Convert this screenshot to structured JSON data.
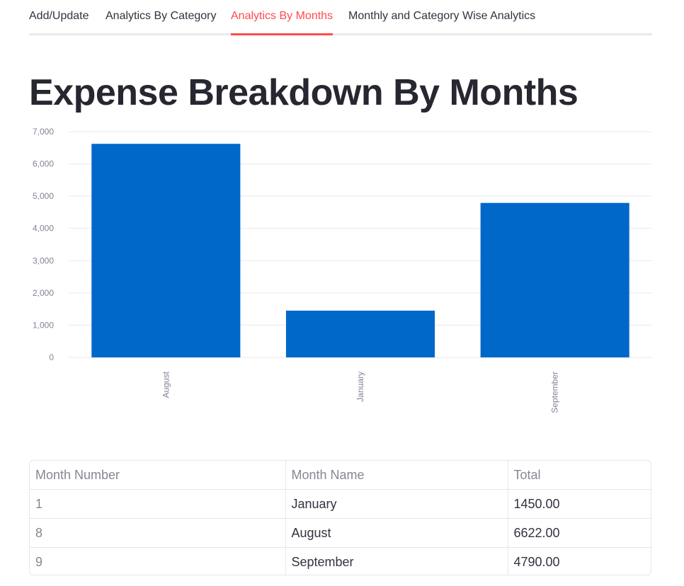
{
  "tabs": [
    {
      "label": "Add/Update",
      "active": false
    },
    {
      "label": "Analytics By Category",
      "active": false
    },
    {
      "label": "Analytics By Months",
      "active": true
    },
    {
      "label": "Monthly and Category Wise Analytics",
      "active": false
    }
  ],
  "page_title": "Expense Breakdown By Months",
  "colors": {
    "accent": "#ff4b4b",
    "bar": "#0068c9"
  },
  "chart_data": {
    "type": "bar",
    "categories": [
      "August",
      "January",
      "September"
    ],
    "values": [
      6622,
      1450,
      4790
    ],
    "ylim": [
      0,
      7000
    ],
    "yticks": [
      "0",
      "1,000",
      "2,000",
      "3,000",
      "4,000",
      "5,000",
      "6,000",
      "7,000"
    ],
    "ytick_values": [
      0,
      1000,
      2000,
      3000,
      4000,
      5000,
      6000,
      7000
    ],
    "grid": true,
    "xlabel": "",
    "ylabel": ""
  },
  "table": {
    "headers": [
      "Month Number",
      "Month Name",
      "Total"
    ],
    "rows": [
      [
        "1",
        "January",
        "1450.00"
      ],
      [
        "8",
        "August",
        "6622.00"
      ],
      [
        "9",
        "September",
        "4790.00"
      ]
    ]
  }
}
